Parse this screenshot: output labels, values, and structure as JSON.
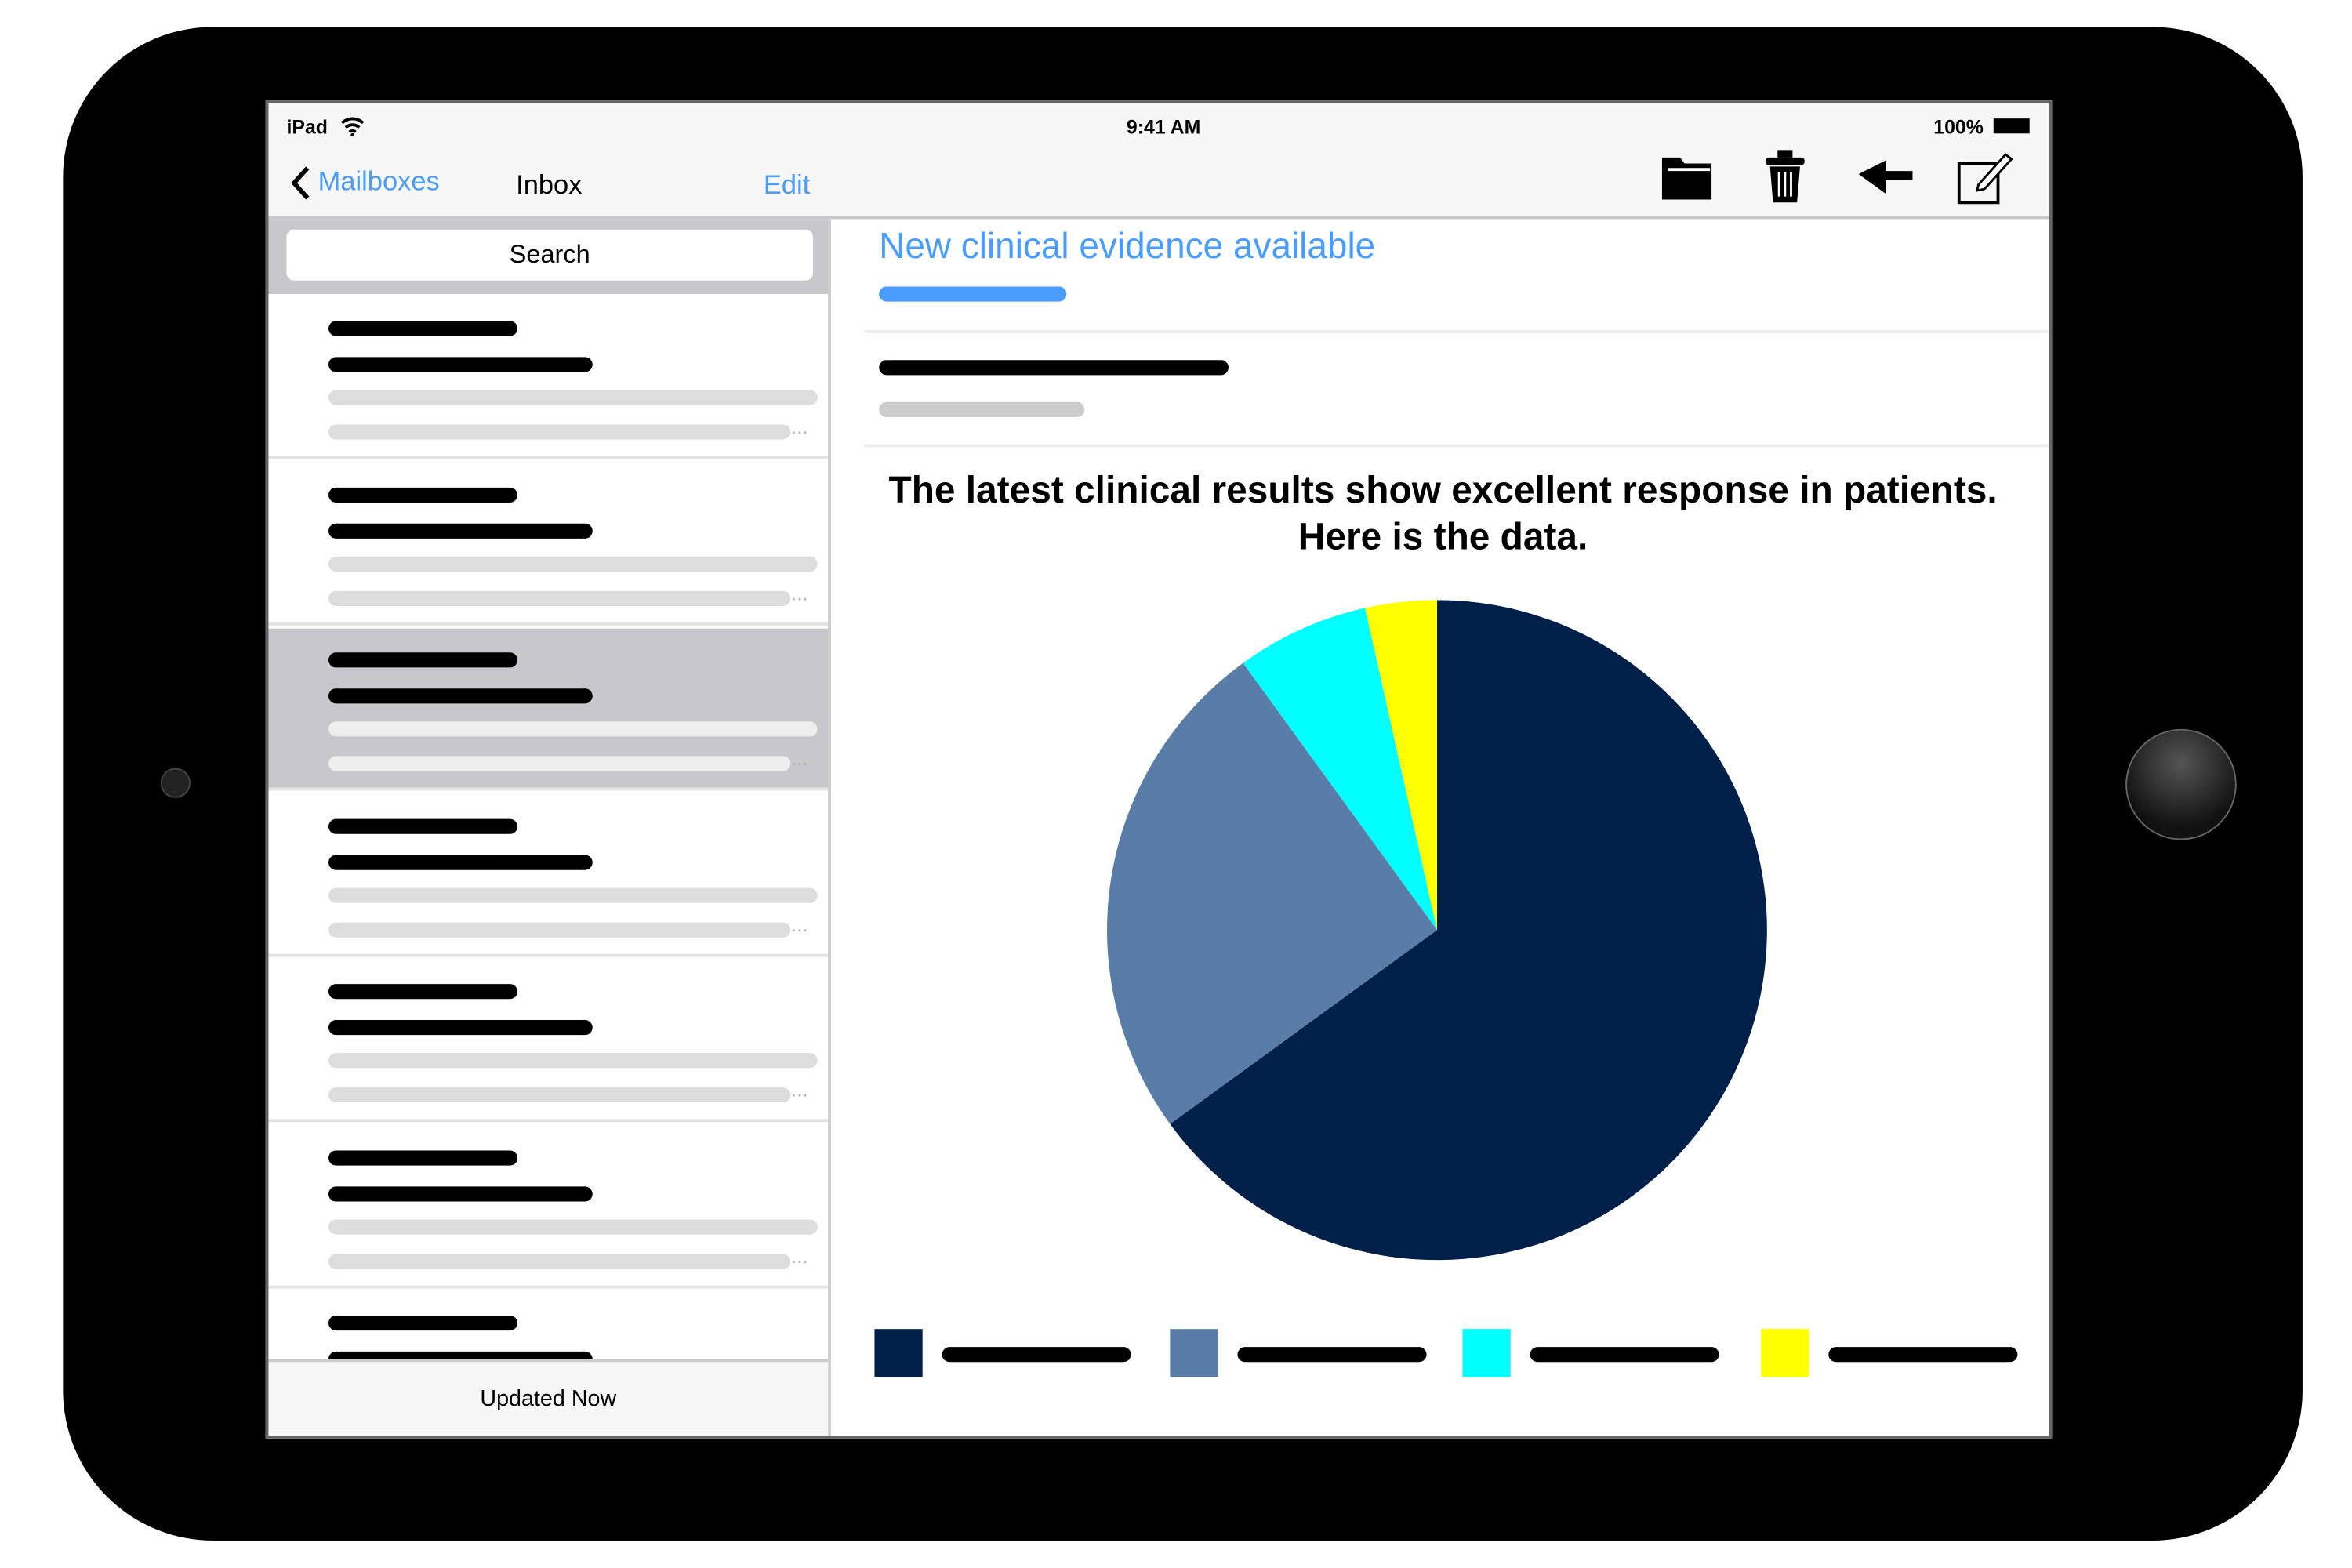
{
  "status_bar": {
    "device": "iPad",
    "time": "9:41 AM",
    "battery": "100%"
  },
  "nav": {
    "back_label": "Mailboxes",
    "title": "Inbox",
    "edit_label": "Edit",
    "icons": [
      "folder-icon",
      "trash-icon",
      "reply-icon",
      "compose-icon"
    ]
  },
  "sidebar": {
    "search_placeholder": "Search",
    "footer": "Updated Now",
    "selected_index": 2,
    "item_count": 7
  },
  "message": {
    "subject": "New clinical evidence available",
    "heading_line1": "The latest clinical results show excellent response in patients.",
    "heading_line2": "Here is the data."
  },
  "colors": {
    "accent": "#4a9cff",
    "selected": "#c8c8cc"
  },
  "chart_data": {
    "type": "pie",
    "values": [
      65,
      25,
      6.5,
      3.5
    ],
    "colors": [
      "#00204a",
      "#5a7da8",
      "#00ffff",
      "#ffff00"
    ],
    "start_angle_deg": 0,
    "direction": "clockwise",
    "legend": "bottom"
  }
}
